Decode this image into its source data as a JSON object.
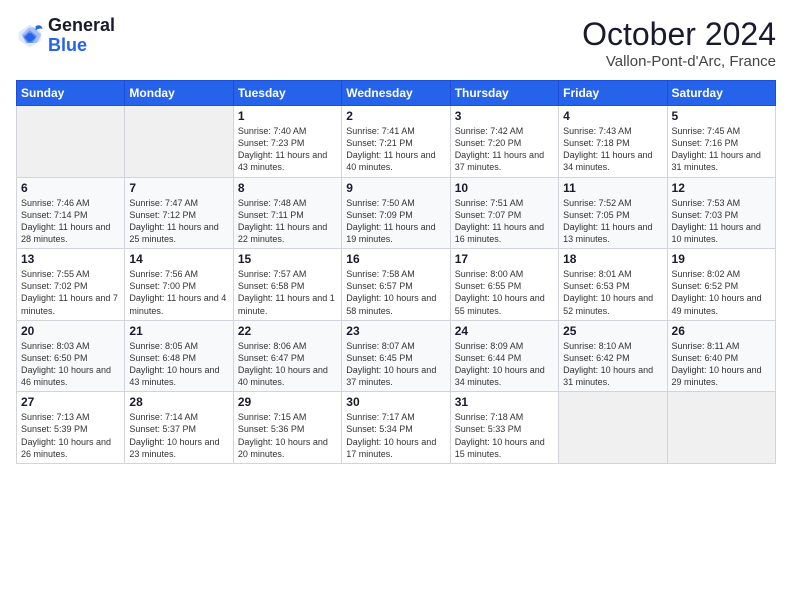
{
  "logo": {
    "line1": "General",
    "line2": "Blue"
  },
  "title": "October 2024",
  "subtitle": "Vallon-Pont-d'Arc, France",
  "days_of_week": [
    "Sunday",
    "Monday",
    "Tuesday",
    "Wednesday",
    "Thursday",
    "Friday",
    "Saturday"
  ],
  "weeks": [
    [
      {
        "day": "",
        "info": ""
      },
      {
        "day": "",
        "info": ""
      },
      {
        "day": "1",
        "info": "Sunrise: 7:40 AM\nSunset: 7:23 PM\nDaylight: 11 hours and 43 minutes."
      },
      {
        "day": "2",
        "info": "Sunrise: 7:41 AM\nSunset: 7:21 PM\nDaylight: 11 hours and 40 minutes."
      },
      {
        "day": "3",
        "info": "Sunrise: 7:42 AM\nSunset: 7:20 PM\nDaylight: 11 hours and 37 minutes."
      },
      {
        "day": "4",
        "info": "Sunrise: 7:43 AM\nSunset: 7:18 PM\nDaylight: 11 hours and 34 minutes."
      },
      {
        "day": "5",
        "info": "Sunrise: 7:45 AM\nSunset: 7:16 PM\nDaylight: 11 hours and 31 minutes."
      }
    ],
    [
      {
        "day": "6",
        "info": "Sunrise: 7:46 AM\nSunset: 7:14 PM\nDaylight: 11 hours and 28 minutes."
      },
      {
        "day": "7",
        "info": "Sunrise: 7:47 AM\nSunset: 7:12 PM\nDaylight: 11 hours and 25 minutes."
      },
      {
        "day": "8",
        "info": "Sunrise: 7:48 AM\nSunset: 7:11 PM\nDaylight: 11 hours and 22 minutes."
      },
      {
        "day": "9",
        "info": "Sunrise: 7:50 AM\nSunset: 7:09 PM\nDaylight: 11 hours and 19 minutes."
      },
      {
        "day": "10",
        "info": "Sunrise: 7:51 AM\nSunset: 7:07 PM\nDaylight: 11 hours and 16 minutes."
      },
      {
        "day": "11",
        "info": "Sunrise: 7:52 AM\nSunset: 7:05 PM\nDaylight: 11 hours and 13 minutes."
      },
      {
        "day": "12",
        "info": "Sunrise: 7:53 AM\nSunset: 7:03 PM\nDaylight: 11 hours and 10 minutes."
      }
    ],
    [
      {
        "day": "13",
        "info": "Sunrise: 7:55 AM\nSunset: 7:02 PM\nDaylight: 11 hours and 7 minutes."
      },
      {
        "day": "14",
        "info": "Sunrise: 7:56 AM\nSunset: 7:00 PM\nDaylight: 11 hours and 4 minutes."
      },
      {
        "day": "15",
        "info": "Sunrise: 7:57 AM\nSunset: 6:58 PM\nDaylight: 11 hours and 1 minute."
      },
      {
        "day": "16",
        "info": "Sunrise: 7:58 AM\nSunset: 6:57 PM\nDaylight: 10 hours and 58 minutes."
      },
      {
        "day": "17",
        "info": "Sunrise: 8:00 AM\nSunset: 6:55 PM\nDaylight: 10 hours and 55 minutes."
      },
      {
        "day": "18",
        "info": "Sunrise: 8:01 AM\nSunset: 6:53 PM\nDaylight: 10 hours and 52 minutes."
      },
      {
        "day": "19",
        "info": "Sunrise: 8:02 AM\nSunset: 6:52 PM\nDaylight: 10 hours and 49 minutes."
      }
    ],
    [
      {
        "day": "20",
        "info": "Sunrise: 8:03 AM\nSunset: 6:50 PM\nDaylight: 10 hours and 46 minutes."
      },
      {
        "day": "21",
        "info": "Sunrise: 8:05 AM\nSunset: 6:48 PM\nDaylight: 10 hours and 43 minutes."
      },
      {
        "day": "22",
        "info": "Sunrise: 8:06 AM\nSunset: 6:47 PM\nDaylight: 10 hours and 40 minutes."
      },
      {
        "day": "23",
        "info": "Sunrise: 8:07 AM\nSunset: 6:45 PM\nDaylight: 10 hours and 37 minutes."
      },
      {
        "day": "24",
        "info": "Sunrise: 8:09 AM\nSunset: 6:44 PM\nDaylight: 10 hours and 34 minutes."
      },
      {
        "day": "25",
        "info": "Sunrise: 8:10 AM\nSunset: 6:42 PM\nDaylight: 10 hours and 31 minutes."
      },
      {
        "day": "26",
        "info": "Sunrise: 8:11 AM\nSunset: 6:40 PM\nDaylight: 10 hours and 29 minutes."
      }
    ],
    [
      {
        "day": "27",
        "info": "Sunrise: 7:13 AM\nSunset: 5:39 PM\nDaylight: 10 hours and 26 minutes."
      },
      {
        "day": "28",
        "info": "Sunrise: 7:14 AM\nSunset: 5:37 PM\nDaylight: 10 hours and 23 minutes."
      },
      {
        "day": "29",
        "info": "Sunrise: 7:15 AM\nSunset: 5:36 PM\nDaylight: 10 hours and 20 minutes."
      },
      {
        "day": "30",
        "info": "Sunrise: 7:17 AM\nSunset: 5:34 PM\nDaylight: 10 hours and 17 minutes."
      },
      {
        "day": "31",
        "info": "Sunrise: 7:18 AM\nSunset: 5:33 PM\nDaylight: 10 hours and 15 minutes."
      },
      {
        "day": "",
        "info": ""
      },
      {
        "day": "",
        "info": ""
      }
    ]
  ]
}
